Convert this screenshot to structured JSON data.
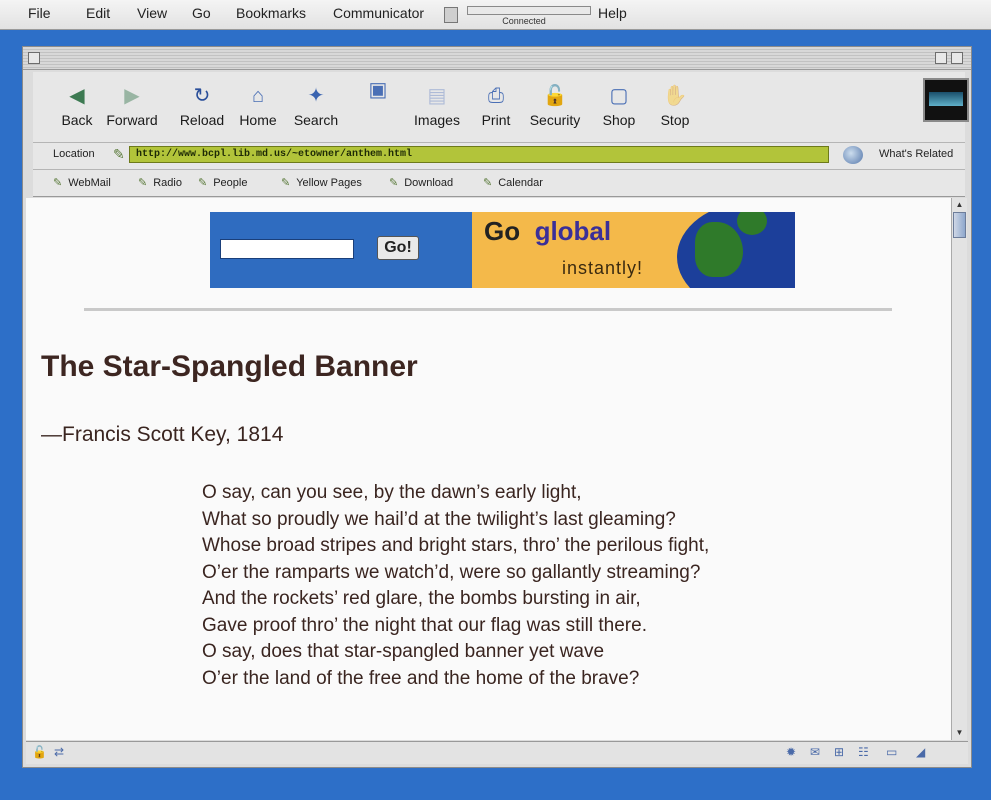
{
  "menubar": {
    "items": [
      "File",
      "Edit",
      "View",
      "Go",
      "Bookmarks",
      "Communicator",
      "Help"
    ],
    "connection_status": "Connected"
  },
  "toolbar": {
    "buttons": [
      {
        "label": "Back",
        "icon": "back-arrow-icon"
      },
      {
        "label": "Forward",
        "icon": "forward-arrow-icon"
      },
      {
        "label": "Reload",
        "icon": "reload-icon"
      },
      {
        "label": "Home",
        "icon": "home-icon"
      },
      {
        "label": "Search",
        "icon": "search-icon"
      },
      {
        "label": "Images",
        "icon": "images-icon"
      },
      {
        "label": "Print",
        "icon": "print-icon"
      },
      {
        "label": "Security",
        "icon": "security-lock-icon"
      },
      {
        "label": "Shop",
        "icon": "shop-icon"
      },
      {
        "label": "Stop",
        "icon": "stop-icon"
      }
    ]
  },
  "location": {
    "label": "Location",
    "url": "http://www.bcpl.lib.md.us/~etowner/anthem.html",
    "related_label": "What's Related"
  },
  "personal_toolbar": {
    "items": [
      "WebMail",
      "Radio",
      "People",
      "Yellow Pages",
      "Download",
      "Calendar"
    ]
  },
  "banner": {
    "button_label": "Go!",
    "headline_part1": "Go",
    "headline_part2": "global",
    "subline": "instantly!"
  },
  "page": {
    "title": "The Star-Spangled Banner",
    "author": "—Francis Scott Key, 1814",
    "verse": [
      "O say, can you see, by the dawn’s early light,",
      "What so proudly we hail’d at the twilight’s last gleaming?",
      "Whose broad stripes and bright stars, thro’ the perilous fight,",
      "O’er the ramparts we watch’d, were so gallantly streaming?",
      "And the rockets’ red glare, the bombs bursting in air,",
      "Gave proof thro’ the night that our flag was still there.",
      "O say, does that star-spangled banner yet wave",
      "O’er the land of the free and the home of the brave?"
    ]
  },
  "colors": {
    "desktop": "#2d6fc8",
    "location_field": "#b2c43a",
    "banner_blue": "#2f6cc0",
    "banner_orange": "#f4b94a",
    "title_text": "#3d2621"
  }
}
